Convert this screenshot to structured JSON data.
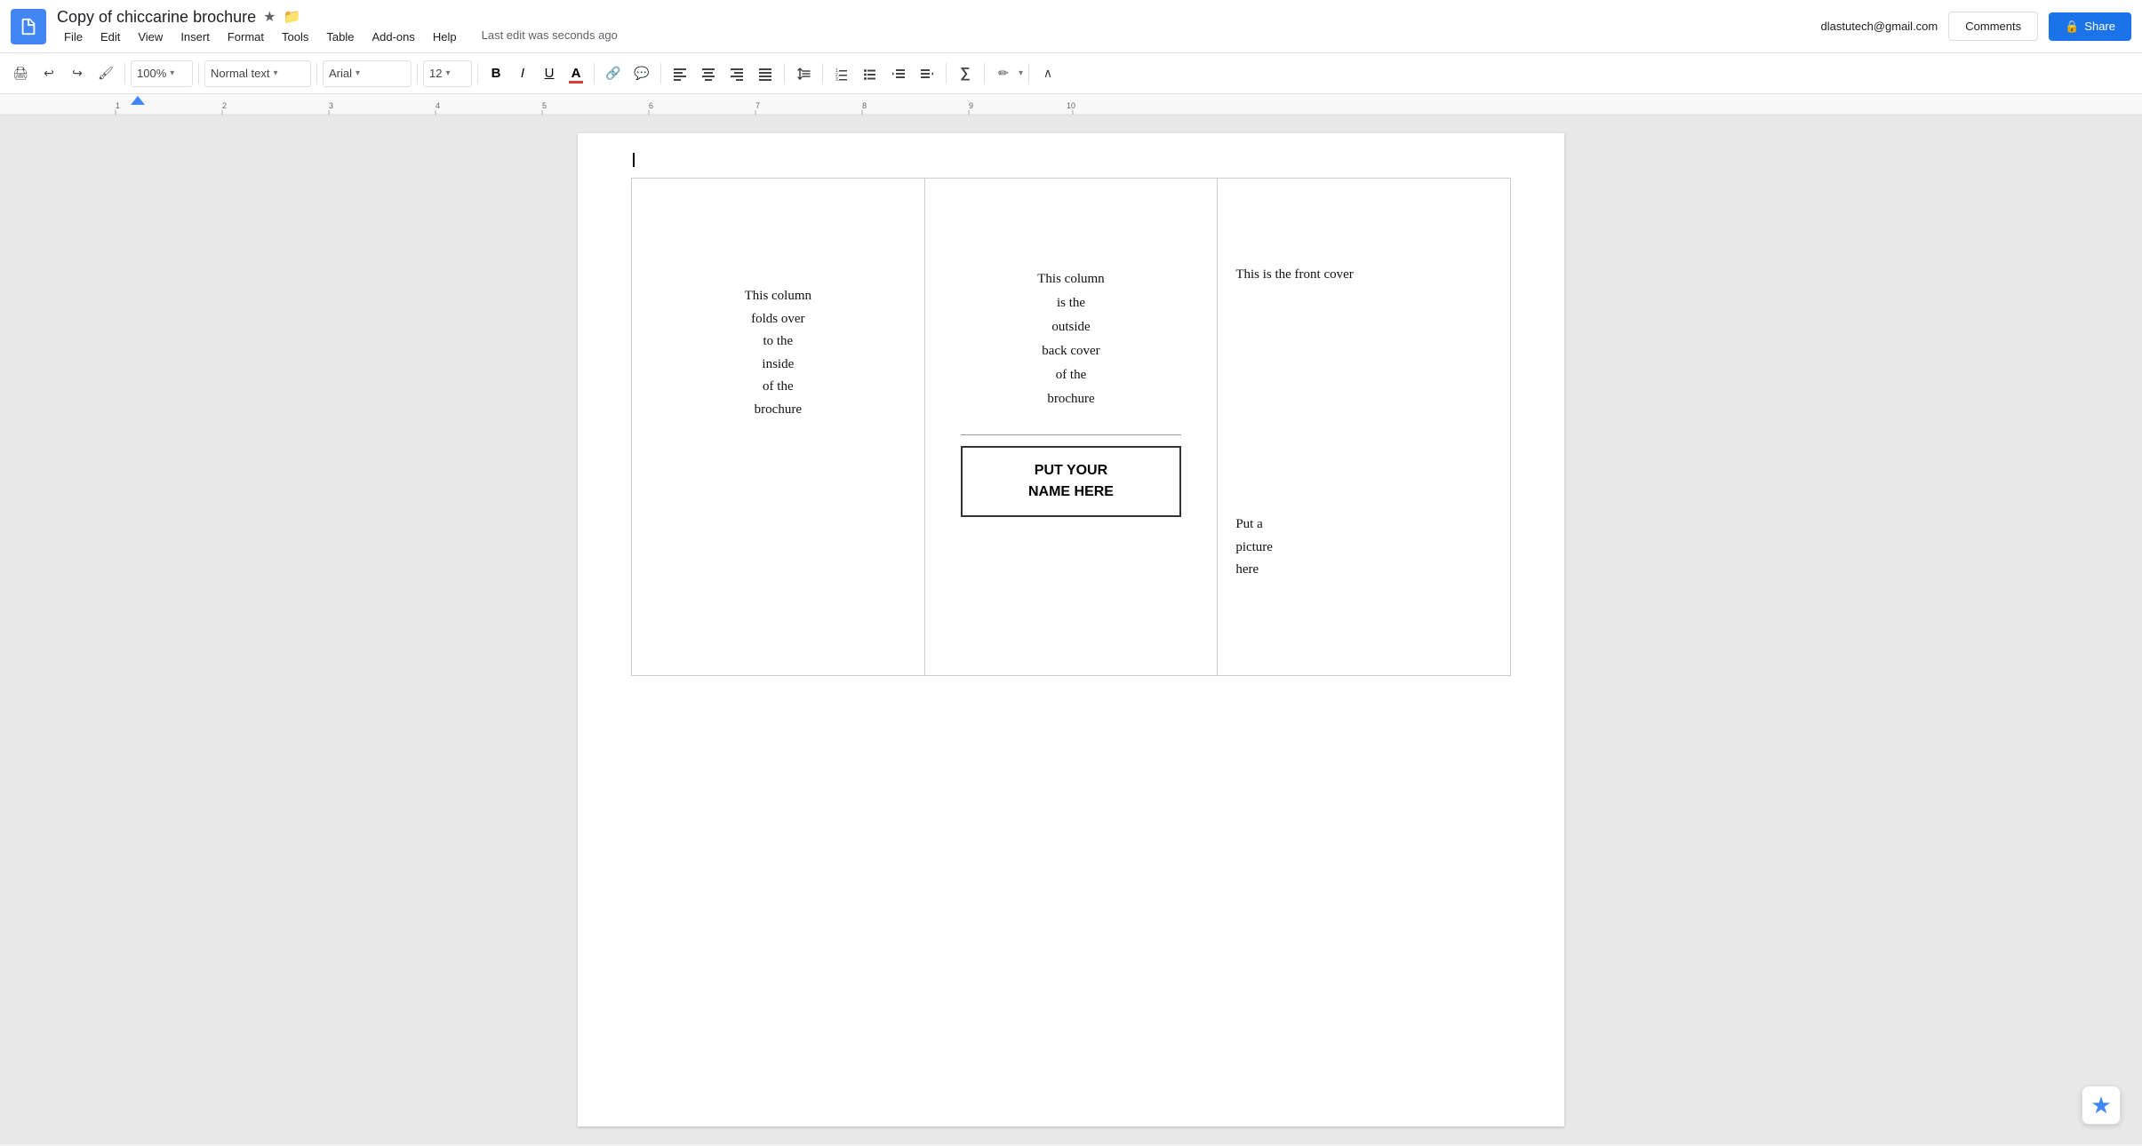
{
  "header": {
    "app_icon_label": "Docs",
    "doc_title": "Copy of chiccarine brochure",
    "star_icon": "★",
    "folder_icon": "📁",
    "user_email": "dlastutech@gmail.com",
    "dropdown_arrow": "▾",
    "comments_label": "Comments",
    "share_label": "Share",
    "share_lock_icon": "🔒"
  },
  "menu": {
    "file": "File",
    "edit": "Edit",
    "view": "View",
    "insert": "Insert",
    "format": "Format",
    "tools": "Tools",
    "table": "Table",
    "addons": "Add-ons",
    "help": "Help",
    "save_status": "Last edit was seconds ago"
  },
  "toolbar": {
    "print_icon": "🖨",
    "undo_icon": "↩",
    "redo_icon": "↪",
    "paintformat_icon": "🖌",
    "zoom_value": "100%",
    "zoom_arrow": "▾",
    "font_style": "Normal text",
    "font_style_arrow": "▾",
    "font_name": "Arial",
    "font_name_arrow": "▾",
    "font_size": "12",
    "font_size_arrow": "▾",
    "bold_label": "B",
    "italic_label": "I",
    "underline_label": "U",
    "text_color_label": "A",
    "link_icon": "🔗",
    "comment_icon": "💬",
    "align_left": "≡",
    "align_center": "≡",
    "align_right": "≡",
    "align_justify": "≡",
    "line_spacing_icon": "↕",
    "numbered_list_icon": "≡",
    "bullet_list_icon": "≡",
    "indent_less_icon": "←",
    "indent_more_icon": "→",
    "formula_icon": "∑",
    "pen_icon": "✏",
    "collapse_icon": "∧"
  },
  "document": {
    "col1_text": "This column\nfolds over\nto the\ninside\nof the\nbrochure",
    "col2_top_text": "This column\nis the\noutside\nback cover\nof the\nbrochure",
    "name_box_line1": "PUT YOUR",
    "name_box_line2": "NAME HERE",
    "col3_front_text": "This is the front cover",
    "col3_picture_text": "Put a\npicture\nhere"
  }
}
